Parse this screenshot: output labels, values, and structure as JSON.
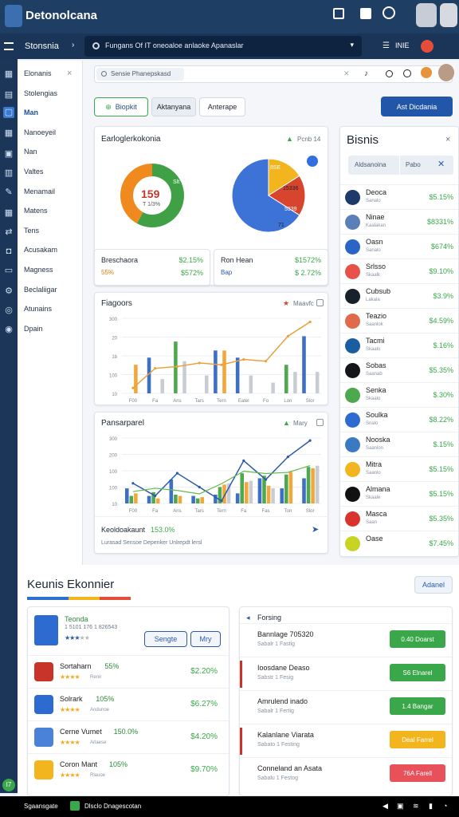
{
  "app": {
    "title": "Detonolcana"
  },
  "topbar": {
    "icons": [
      "grid-icon",
      "download-icon",
      "refresh-icon"
    ]
  },
  "navbar": {
    "brand": "Stonsnia",
    "breadcrumb": "Fungans Of IT oneoaloe anlaoke Apanaslar",
    "right_label": "INIE"
  },
  "sidebar": {
    "items": [
      {
        "label": "Elonanis",
        "active": false
      },
      {
        "label": "Stolengias",
        "active": false
      },
      {
        "label": "Man",
        "active": true
      },
      {
        "label": "Nanoeyeil",
        "active": false
      },
      {
        "label": "Nan",
        "active": false
      },
      {
        "label": "Valtes",
        "active": false
      },
      {
        "label": "Menamail",
        "active": false
      },
      {
        "label": "Matens",
        "active": false
      },
      {
        "label": "Tens",
        "active": false
      },
      {
        "label": "Acusakam",
        "active": false
      },
      {
        "label": "Magness",
        "active": false
      },
      {
        "label": "Beclaliigar",
        "active": false
      },
      {
        "label": "Atunains",
        "active": false
      },
      {
        "label": "Dpain",
        "active": false
      }
    ]
  },
  "search": {
    "placeholder": "Sensie Phanepskasd"
  },
  "filters": {
    "primary": "Biopkit",
    "secondary": [
      "Aktanyana",
      "Anterape"
    ],
    "action": "Ast Dicdania"
  },
  "overview": {
    "title": "Earloglerkokonia",
    "trend_label": "Pcnb 14",
    "donut": {
      "center_value": "159",
      "center_sub": "T 1/3%",
      "side_label": "Slt",
      "segments": [
        {
          "value": 58,
          "color": "#3fa046"
        },
        {
          "value": 42,
          "color": "#f08a1e"
        }
      ]
    },
    "pie": {
      "labels": [
        "8SE",
        "15336",
        "5339",
        "71"
      ],
      "segments": [
        {
          "value": 66,
          "color": "#3d72d6"
        },
        {
          "value": 16,
          "color": "#f2b51d"
        },
        {
          "value": 18,
          "color": "#d8452e"
        }
      ]
    },
    "stat_left": {
      "name": "Breschaora",
      "sub": "55%",
      "value1": "$2.15%",
      "value2": "$572%"
    },
    "stat_right": {
      "name": "Ron Hean",
      "sub": "Bap",
      "value1": "$1572%",
      "value2": "$ 2.72%"
    }
  },
  "chart1": {
    "title": "Fiagoors",
    "legend": "Maavfc",
    "yticks": [
      "300",
      "20",
      "1b",
      "100",
      "10"
    ],
    "xticks": [
      "F00",
      "Fa",
      "Ans",
      "Tars",
      "Tern",
      "Eatel",
      "Fo",
      "Lon",
      "Slor"
    ],
    "chart_data": {
      "type": "bar",
      "series": [
        {
          "name": "",
          "color": "#3d6fc4",
          "values": [
            0,
            100,
            0,
            0,
            120,
            100,
            0,
            0,
            160
          ]
        },
        {
          "name": "",
          "color": "#4da84e",
          "values": [
            0,
            0,
            145,
            0,
            0,
            0,
            0,
            80,
            0
          ]
        },
        {
          "name": "",
          "color": "#f2a73a",
          "values": [
            80,
            0,
            0,
            0,
            120,
            0,
            0,
            0,
            0
          ]
        },
        {
          "name": "",
          "color": "#c9cdd3",
          "values": [
            0,
            40,
            90,
            50,
            0,
            50,
            30,
            60,
            60
          ]
        }
      ],
      "line": [
        15,
        70,
        75,
        85,
        80,
        95,
        90,
        160,
        200
      ]
    }
  },
  "chart2": {
    "title": "Pansarparel",
    "legend": "Mary",
    "yticks": [
      "300",
      "200",
      "100",
      "100",
      "10"
    ],
    "xticks": [
      "F00",
      "Fa",
      "Ans",
      "Tars",
      "Tern",
      "Fa",
      "Fas",
      "Ton",
      "Slor"
    ],
    "chart_data": {
      "type": "bar",
      "series": [
        {
          "name": "",
          "color": "#3d6fc4",
          "values": [
            60,
            30,
            95,
            30,
            35,
            40,
            100,
            60,
            100
          ]
        },
        {
          "name": "",
          "color": "#4da84e",
          "values": [
            30,
            45,
            35,
            20,
            65,
            120,
            110,
            115,
            145
          ]
        },
        {
          "name": "",
          "color": "#f2a73a",
          "values": [
            40,
            20,
            30,
            25,
            75,
            85,
            70,
            125,
            140
          ]
        },
        {
          "name": "",
          "color": "#c9cdd3",
          "values": [
            0,
            0,
            0,
            0,
            80,
            90,
            60,
            0,
            150
          ]
        }
      ],
      "line": [
        80,
        30,
        120,
        65,
        10,
        170,
        95,
        185,
        250
      ]
    },
    "footer_title": "Keoldoakaunt",
    "footer_value": "153.0%",
    "footer_caption": "Lurasad Sensoe Depenker  Unlrepdt lersl"
  },
  "assets": {
    "title": "Bisnis",
    "tabs": [
      "Aldsanoina",
      "Pabo"
    ],
    "items": [
      {
        "name": "Deoca",
        "sub": "Sanalo",
        "value": "$5.15%",
        "color": "#1d3a6b"
      },
      {
        "name": "Ninae",
        "sub": "Kaalakan",
        "value": "$8331%",
        "color": "#5b7fb8"
      },
      {
        "name": "Oasn",
        "sub": "Sanalo",
        "value": "$674%",
        "color": "#2b64c7"
      },
      {
        "name": "Srlsso",
        "sub": "Skaalk",
        "value": "$9.10%",
        "color": "#e8504a"
      },
      {
        "name": "Cubsub",
        "sub": "Lakala",
        "value": "$3.9%",
        "color": "#18202a"
      },
      {
        "name": "Teazio",
        "sub": "Saanlok",
        "value": "$4.59%",
        "color": "#e06a4a"
      },
      {
        "name": "Tacmi",
        "sub": "Skaalo",
        "value": "$.16%",
        "color": "#1b5da1"
      },
      {
        "name": "Sobas",
        "sub": "Saanab",
        "value": "$5.35%",
        "color": "#14161a"
      },
      {
        "name": "Senka",
        "sub": "Skaalo",
        "value": "$.30%",
        "color": "#4da84e"
      },
      {
        "name": "Soulka",
        "sub": "Snalo",
        "value": "$8.22%",
        "color": "#2e6bd0"
      },
      {
        "name": "Nooska",
        "sub": "Saanlon",
        "value": "$.15%",
        "color": "#3b7ac2"
      },
      {
        "name": "Mitra",
        "sub": "Saanlo",
        "value": "$5.15%",
        "color": "#f2b51d"
      },
      {
        "name": "Almana",
        "sub": "Skaale",
        "value": "$5.15%",
        "color": "#111"
      },
      {
        "name": "Masca",
        "sub": "Saan",
        "value": "$5.35%",
        "color": "#d9342c"
      },
      {
        "name": "Oase",
        "sub": "",
        "value": "$7.45%",
        "color": "#c7d421"
      }
    ]
  },
  "section": {
    "title": "Keunis Ekonnier",
    "action": "Adanel"
  },
  "watchlist": {
    "featured": {
      "name": "Teonda",
      "sub": "1 5101 176 1 826543",
      "btn1": "Sengte",
      "btn2": "Mry"
    },
    "items": [
      {
        "name": "Sortaharn",
        "pct": "55%",
        "sub": "Renir",
        "value": "$2.20%"
      },
      {
        "name": "Solrark",
        "pct": "105%",
        "sub": "Andunoe",
        "value": "$6.27%"
      },
      {
        "name": "Cerne Vumet",
        "pct": "150.0%",
        "sub": "Arlaese",
        "value": "$4.20%"
      },
      {
        "name": "Coron Mant",
        "pct": "105%",
        "sub": "Rlauoe",
        "value": "$9.70%"
      }
    ]
  },
  "orders": {
    "title": "Forsing",
    "items": [
      {
        "name": "Bannlage 705320",
        "sub": "Sabalr 1 Fastig",
        "btn": "0.40 Doarst",
        "color": "#3aa84a"
      },
      {
        "name": "Ioosdane Deaso",
        "sub": "Sabstr 1 Fesig",
        "btn": "S6 Elnarel",
        "color": "#3aa84a"
      },
      {
        "name": "Amrulend inado",
        "sub": "Sabalr 1 Fertig",
        "btn": "1.4 Bangar",
        "color": "#3aa84a"
      },
      {
        "name": "Kalanlane Viarata",
        "sub": "Sabato 1 Festing",
        "btn": "Deal Farrel",
        "color": "#f2b51d"
      },
      {
        "name": "Conneland an Asata",
        "sub": "Sabalu 1 Festog",
        "btn": "76A Farell",
        "color": "#e8505a"
      }
    ]
  },
  "taskbar": {
    "start": "Sgaansgate",
    "app": "Dlsclo Dnagescotan",
    "badge": "I7"
  }
}
